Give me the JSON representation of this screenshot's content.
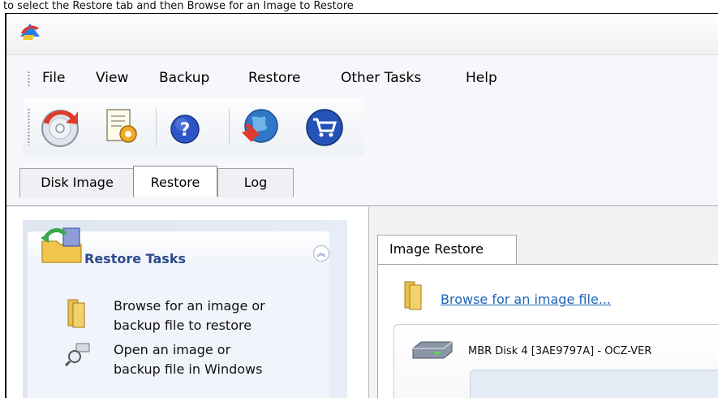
{
  "caption": "to select the Restore tab and then Browse for an Image to Restore",
  "menu": {
    "file": "File",
    "view": "View",
    "backup": "Backup",
    "restore": "Restore",
    "other_tasks": "Other Tasks",
    "help": "Help"
  },
  "toolbar": {
    "icons": [
      "disk-backup-icon",
      "settings-document-icon",
      "help-icon",
      "web-update-icon",
      "shop-cart-icon"
    ]
  },
  "tabs": {
    "disk_image": "Disk Image",
    "restore": "Restore",
    "log": "Log"
  },
  "restore_tasks": {
    "title": "Restore Tasks",
    "browse_line1": "Browse for an image or",
    "browse_line2": "backup file to restore",
    "open_line1": "Open an image or",
    "open_line2": "backup file in Windows"
  },
  "image_restore": {
    "tab_label": "Image Restore",
    "browse_link": "Browse for an image file...",
    "disk_label": "MBR Disk 4 [3AE9797A] - OCZ-VER"
  },
  "colors": {
    "link": "#1c63b7",
    "tasks_title": "#2c4a8c"
  }
}
